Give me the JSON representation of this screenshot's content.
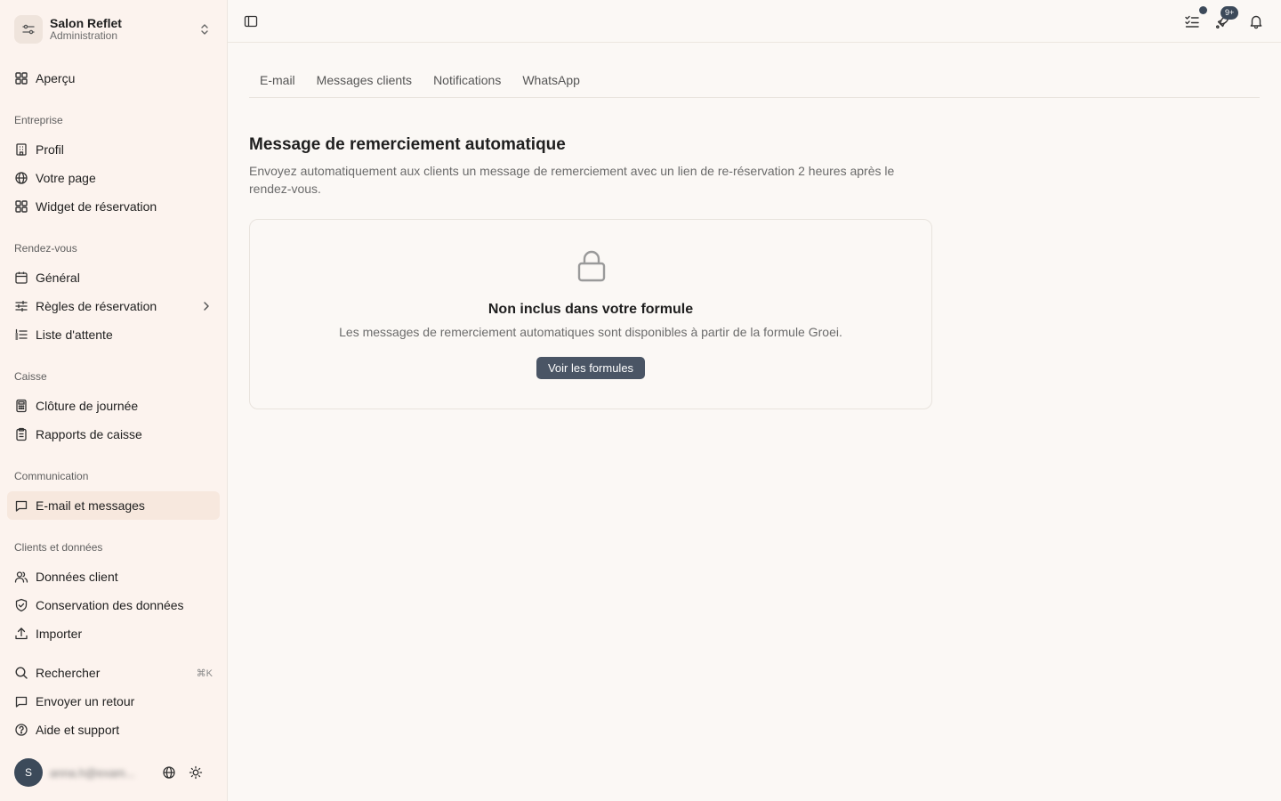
{
  "brand": {
    "name": "Salon Reflet",
    "subtitle": "Administration"
  },
  "nav": {
    "overview": "Aperçu",
    "sections": {
      "company": "Entreprise",
      "appointments": "Rendez-vous",
      "register": "Caisse",
      "communication": "Communication",
      "clients": "Clients et données"
    },
    "profile": "Profil",
    "your_page": "Votre page",
    "booking_widget": "Widget de réservation",
    "general": "Général",
    "booking_rules": "Règles de réservation",
    "waitlist": "Liste d'attente",
    "day_close": "Clôture de journée",
    "register_reports": "Rapports de caisse",
    "email_messages": "E-mail et messages",
    "client_data": "Données client",
    "data_retention": "Conservation des données",
    "import": "Importer",
    "search": "Rechercher",
    "search_shortcut": "⌘K",
    "feedback": "Envoyer un retour",
    "help": "Aide et support"
  },
  "user": {
    "initial": "S",
    "name": "anna.h@exam..."
  },
  "topbar": {
    "badge": "9+"
  },
  "tabs": [
    "E-mail",
    "Messages clients",
    "Notifications",
    "WhatsApp"
  ],
  "main": {
    "title": "Message de remerciement automatique",
    "description": "Envoyez automatiquement aux clients un message de remerciement avec un lien de re-réservation 2 heures après le rendez-vous.",
    "locked_title": "Non inclus dans votre formule",
    "locked_desc": "Les messages de remerciement automatiques sont disponibles à partir de la formule Groei.",
    "cta": "Voir les formules"
  },
  "colors": {
    "sidebar_bg": "#fcf3ee",
    "page_bg": "#fbf8f5",
    "accent": "#4a5565",
    "active_item": "#f7e8de"
  }
}
